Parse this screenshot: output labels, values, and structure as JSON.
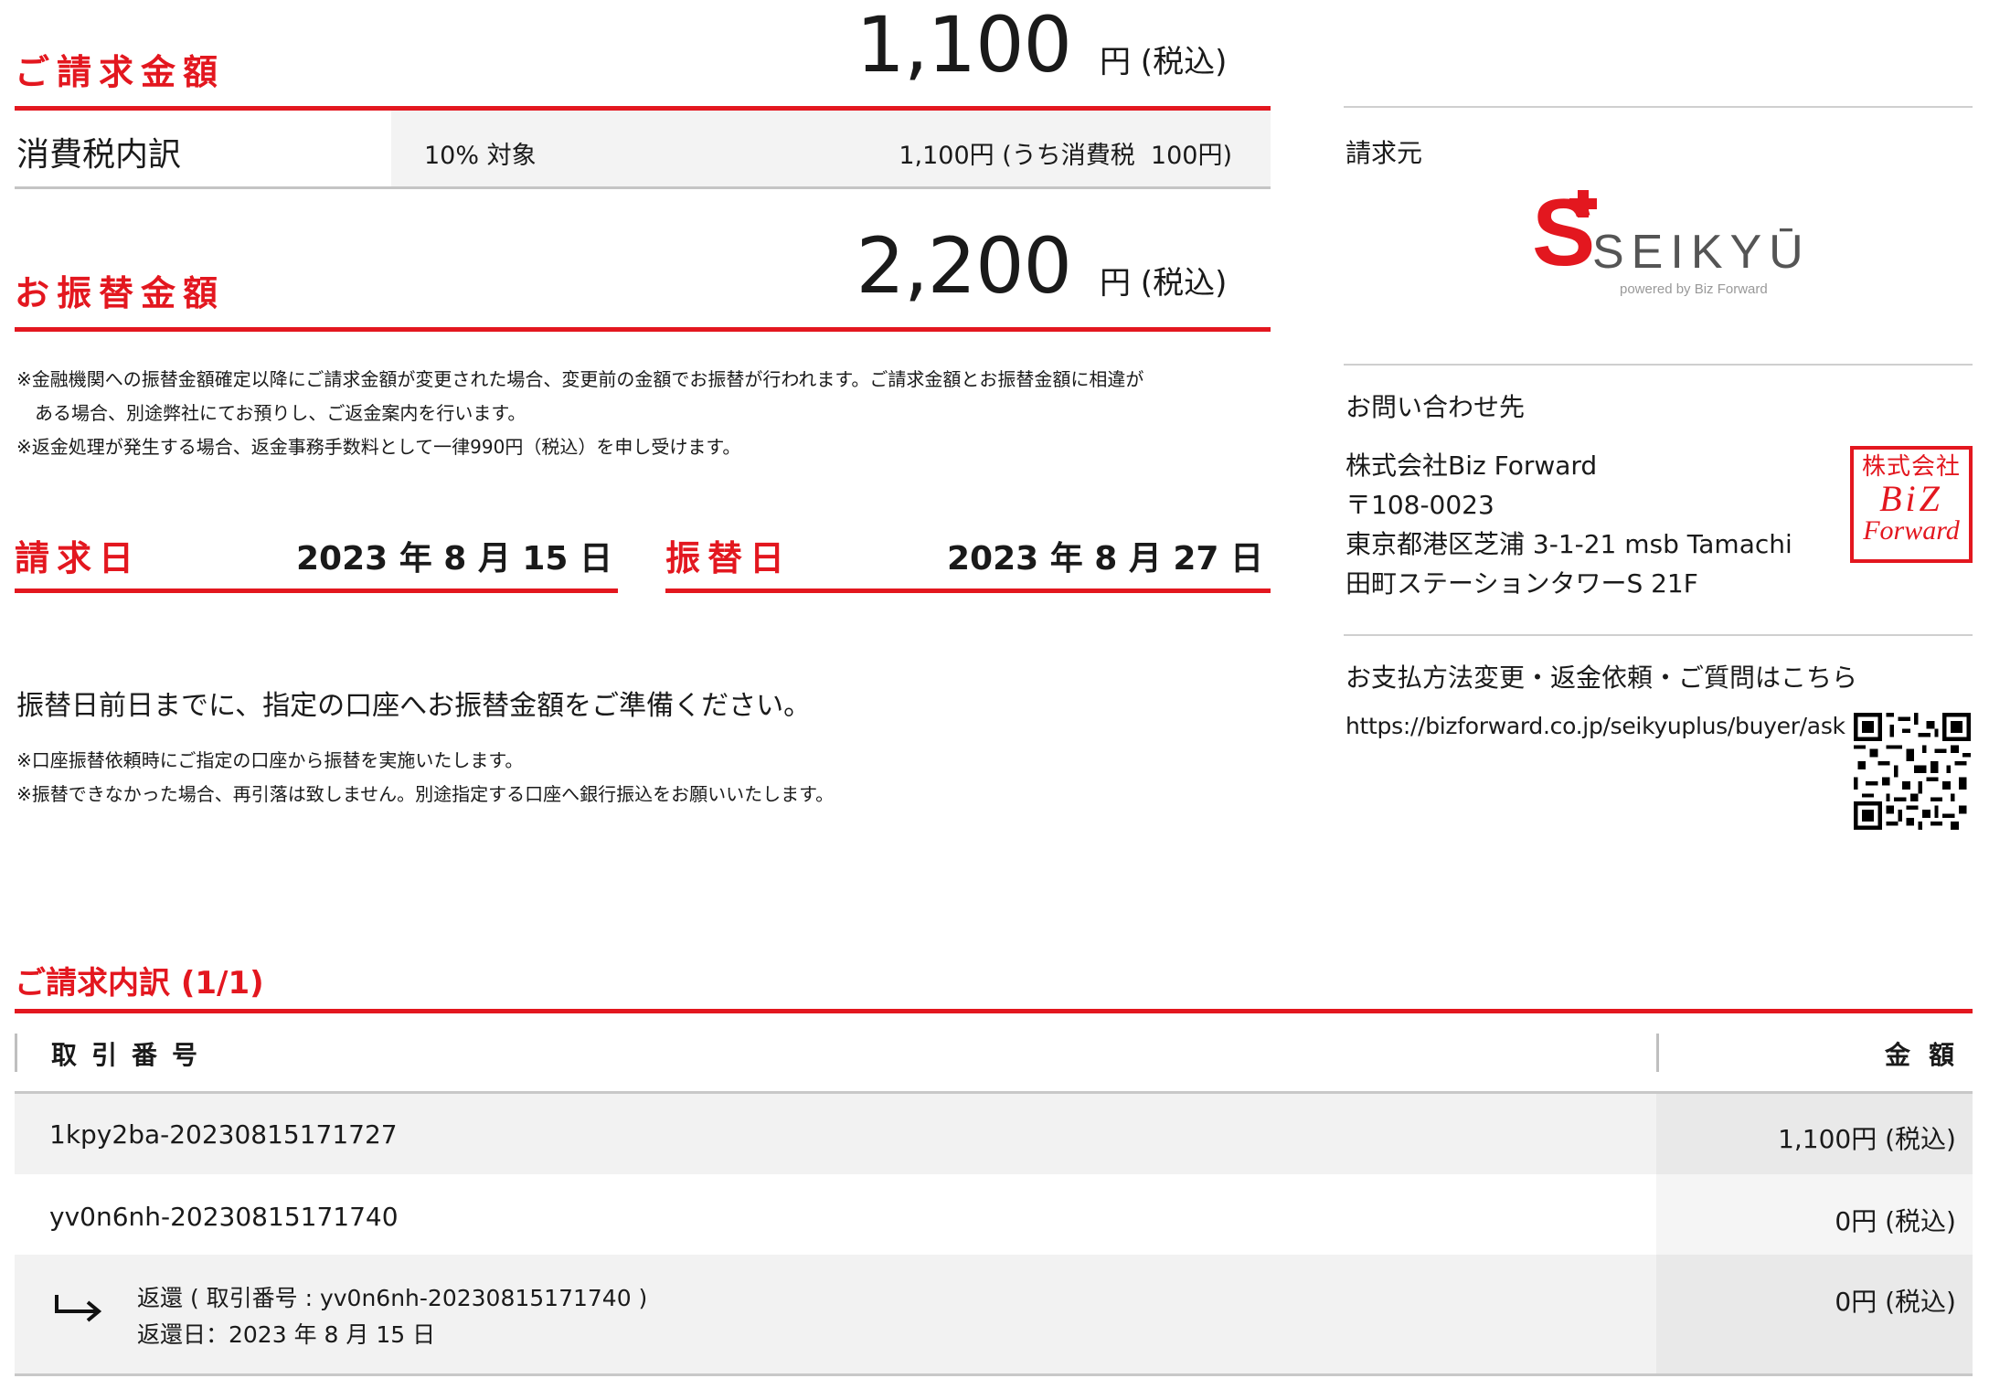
{
  "billing": {
    "label": "ご請求金額",
    "amount": "1,100",
    "unit": "円 (税込)"
  },
  "tax_breakdown": {
    "label": "消費税内訳",
    "rate": "10% 対象",
    "detail": "1,100円 (うち消費税  100円)"
  },
  "transfer": {
    "label": "お振替金額",
    "amount": "2,200",
    "unit": "円 (税込)"
  },
  "notes_top": [
    "※金融機関への振替金額確定以降にご請求金額が変更された場合、変更前の金額でお振替が行われます。ご請求金額とお振替金額に相違が",
    "　ある場合、別途弊社にてお預りし、ご返金案内を行います。",
    "※返金処理が発生する場合、返金事務手数料として一律990円（税込）を申し受けます。"
  ],
  "dates": {
    "billing_label": "請求日",
    "billing_value": "2023 年 8 月 15 日",
    "transfer_label": "振替日",
    "transfer_value": "2023 年 8 月 27 日"
  },
  "prepare_message": "振替日前日までに、指定の口座へお振替金額をご準備ください。",
  "notes_bottom": [
    "※口座振替依頼時にご指定の口座から振替を実施いたします。",
    "※振替できなかった場合、再引落は致しません。別途指定する口座へ銀行振込をお願いいたします。"
  ],
  "sidebar": {
    "issuer_label": "請求元",
    "logo_text": "SEIKYŪ",
    "logo_sub": "powered by Biz Forward",
    "contact_label": "お問い合わせ先",
    "company": "株式会社Biz Forward",
    "postal": "〒108-0023",
    "address1": "東京都港区芝浦 3-1-21 msb Tamachi",
    "address2": "田町ステーションタワーS 21F",
    "seal_text_top": "株式会社",
    "seal_text_mid": "BiZ",
    "seal_text_bot": "Forward",
    "support_label": "お支払方法変更・返金依頼・ご質問はこちら",
    "support_url": "https://bizforward.co.jp/seikyuplus/buyer/ask"
  },
  "details": {
    "title": "ご請求内訳 (1/1)",
    "col_id": "取引番号",
    "col_amount": "金額",
    "rows": [
      {
        "id": "1kpy2ba-20230815171727",
        "amount": "1,100円 (税込)"
      },
      {
        "id": "yv0n6nh-20230815171740",
        "amount": "0円 (税込)"
      }
    ],
    "refund": {
      "line1": "返還 ( 取引番号 : yv0n6nh-20230815171740 )",
      "line2": "返還日：2023 年 8 月 15 日",
      "amount": "0円 (税込)"
    }
  },
  "colors": {
    "accent": "#e3171f",
    "row_gray": "#f2f2f2"
  }
}
